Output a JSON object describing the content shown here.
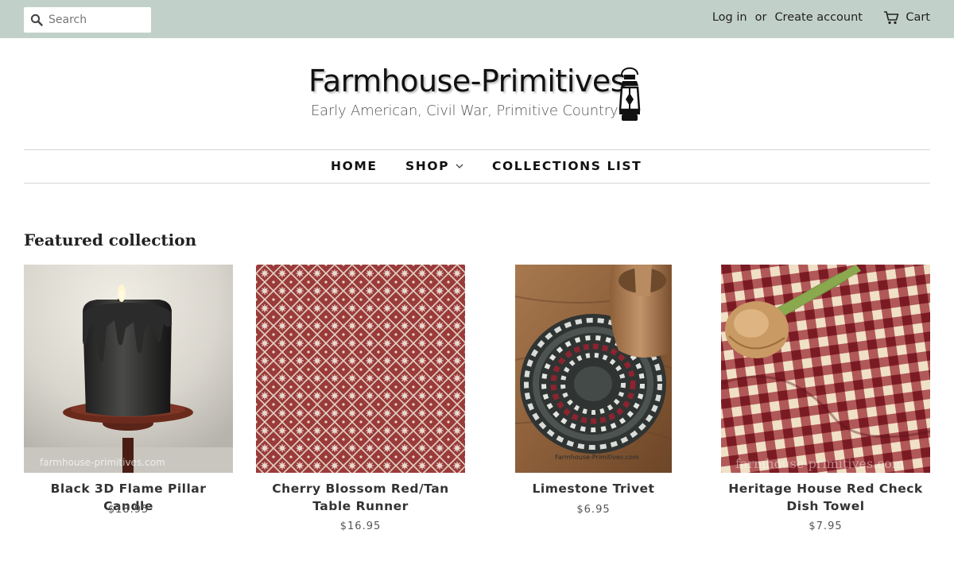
{
  "header": {
    "search_placeholder": "Search",
    "login": "Log in",
    "or": "or",
    "create_account": "Create account",
    "cart": "Cart"
  },
  "logo": {
    "title": "Farmhouse-Primitives",
    "tagline": "Early American, Civil War, Primitive Country"
  },
  "nav": {
    "items": [
      "HOME",
      "SHOP",
      "COLLECTIONS LIST"
    ]
  },
  "featured": {
    "title": "Featured collection",
    "products": [
      {
        "name": "Black 3D Flame Pillar Candle",
        "price": "$18.95",
        "watermark": "farmhouse-primitives.com"
      },
      {
        "name": "Cherry Blossom Red/Tan Table Runner",
        "price": "$16.95"
      },
      {
        "name": "Limestone Trivet",
        "price": "$6.95",
        "watermark": "Farmhouse-Primitives.com"
      },
      {
        "name": "Heritage House Red Check Dish Towel",
        "price": "$7.95",
        "watermark": "farmhouse-primitives.com"
      }
    ]
  },
  "colors": {
    "topbar": "#c2d0ca",
    "text": "#222222"
  }
}
